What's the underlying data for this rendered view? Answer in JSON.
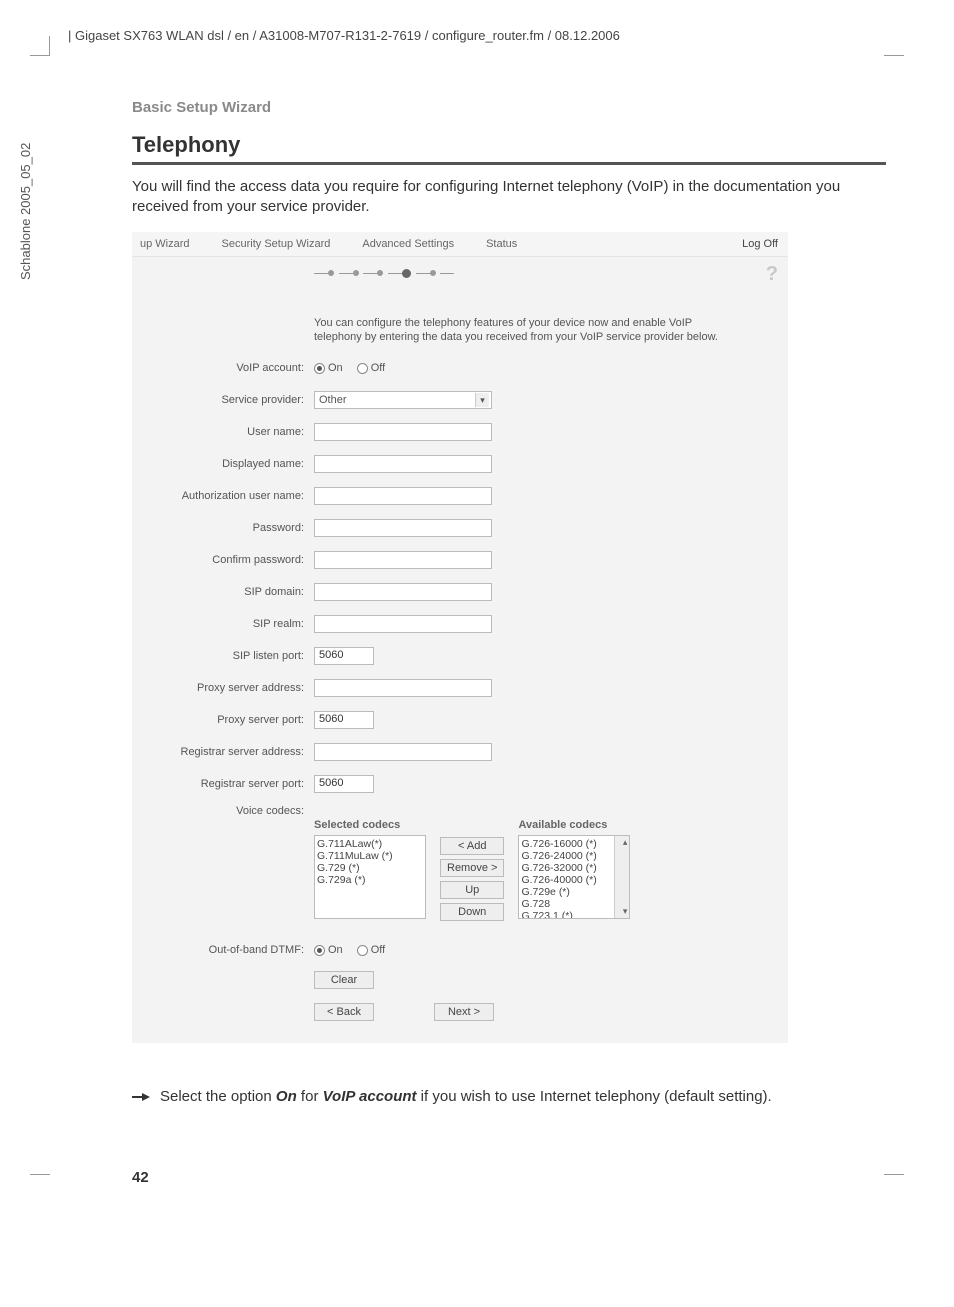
{
  "side_text": "Schablone 2005_05_02",
  "header_path": "| Gigaset SX763 WLAN dsl / en / A31008-M707-R131-2-7619 / configure_router.fm / 08.12.2006",
  "wizard_label": "Basic Setup Wizard",
  "section_title": "Telephony",
  "intro": "You will find the access data you require for configuring Internet telephony (VoIP) in the documentation you received from your service provider.",
  "router": {
    "tabs": [
      "up Wizard",
      "Security Setup Wizard",
      "Advanced Settings",
      "Status"
    ],
    "logoff": "Log Off",
    "config_desc": "You can configure the telephony features of your device now and enable VoIP telephony by entering the data you received from your VoIP service provider below.",
    "labels": {
      "voip_account": "VoIP account:",
      "service_provider": "Service provider:",
      "user_name": "User name:",
      "displayed_name": "Displayed name:",
      "auth_user": "Authorization user name:",
      "password": "Password:",
      "confirm_password": "Confirm password:",
      "sip_domain": "SIP domain:",
      "sip_realm": "SIP realm:",
      "sip_listen_port": "SIP listen port:",
      "proxy_addr": "Proxy server address:",
      "proxy_port": "Proxy server port:",
      "registrar_addr": "Registrar server address:",
      "registrar_port": "Registrar server port:",
      "voice_codecs": "Voice codecs:",
      "oob_dtmf": "Out-of-band DTMF:"
    },
    "values": {
      "on": "On",
      "off": "Off",
      "service_provider": "Other",
      "sip_listen_port": "5060",
      "proxy_port": "5060",
      "registrar_port": "5060"
    },
    "codec": {
      "selected_title": "Selected codecs",
      "available_title": "Available codecs",
      "selected": [
        "G.711ALaw(*)",
        "G.711MuLaw (*)",
        "G.729 (*)",
        "G.729a (*)"
      ],
      "available": [
        "G.726-16000 (*)",
        "G.726-24000 (*)",
        "G.726-32000 (*)",
        "G.726-40000 (*)",
        "G.729e (*)",
        "G.728",
        "G.723.1 (*)"
      ],
      "btn_add": "< Add",
      "btn_remove": "Remove >",
      "btn_up": "Up",
      "btn_down": "Down"
    },
    "buttons": {
      "clear": "Clear",
      "back": "< Back",
      "next": "Next >"
    }
  },
  "bullet_text_parts": {
    "p1": "Select the option ",
    "p2": "On",
    "p3": " for ",
    "p4": "VoIP account",
    "p5": " if you wish to use Internet telephony (default setting)."
  },
  "page_num": "42"
}
